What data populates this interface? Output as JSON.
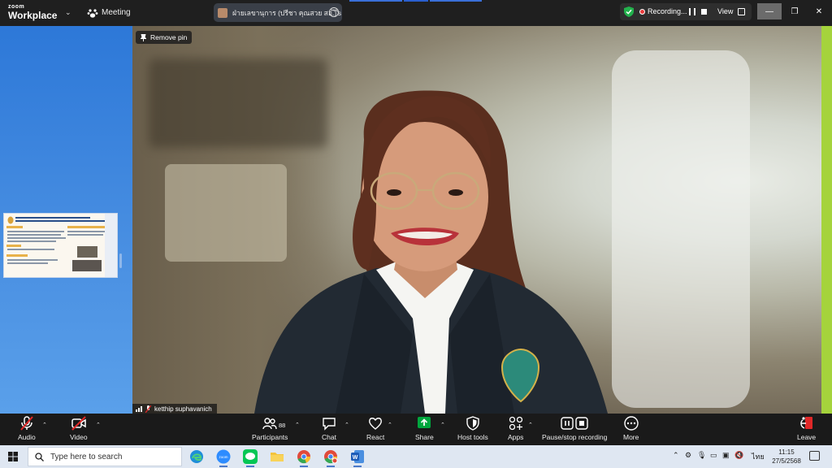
{
  "app": {
    "logo_top": "zoom",
    "logo_bottom": "Workplace",
    "meeting_label": "Meeting"
  },
  "share_pill": {
    "text": "ฝ่ายเลขานุการ (ปรีชา คุณสวย สอ.)'s"
  },
  "recording": {
    "label": "Recording...",
    "view_label": "View"
  },
  "window": {
    "minimize": "—",
    "restore": "❐",
    "close": "✕"
  },
  "video": {
    "remove_pin_label": "Remove pin",
    "participant_name": "ketthip suphavanich"
  },
  "toolbar": {
    "audio": "Audio",
    "video": "Video",
    "participants": "Participants",
    "participants_count": "88",
    "chat": "Chat",
    "react": "React",
    "share": "Share",
    "host_tools": "Host tools",
    "apps": "Apps",
    "pause_stop_recording": "Pause/stop recording",
    "more": "More",
    "leave": "Leave"
  },
  "taskbar": {
    "search_placeholder": "Type here to search",
    "language": "ไทย",
    "time": "11:15",
    "date": "27/5/2568"
  },
  "colors": {
    "share_accent": "#00a63e",
    "leave_red": "#e02828",
    "recording_red": "#e83b3b",
    "green_edge": "#a5d33c"
  }
}
